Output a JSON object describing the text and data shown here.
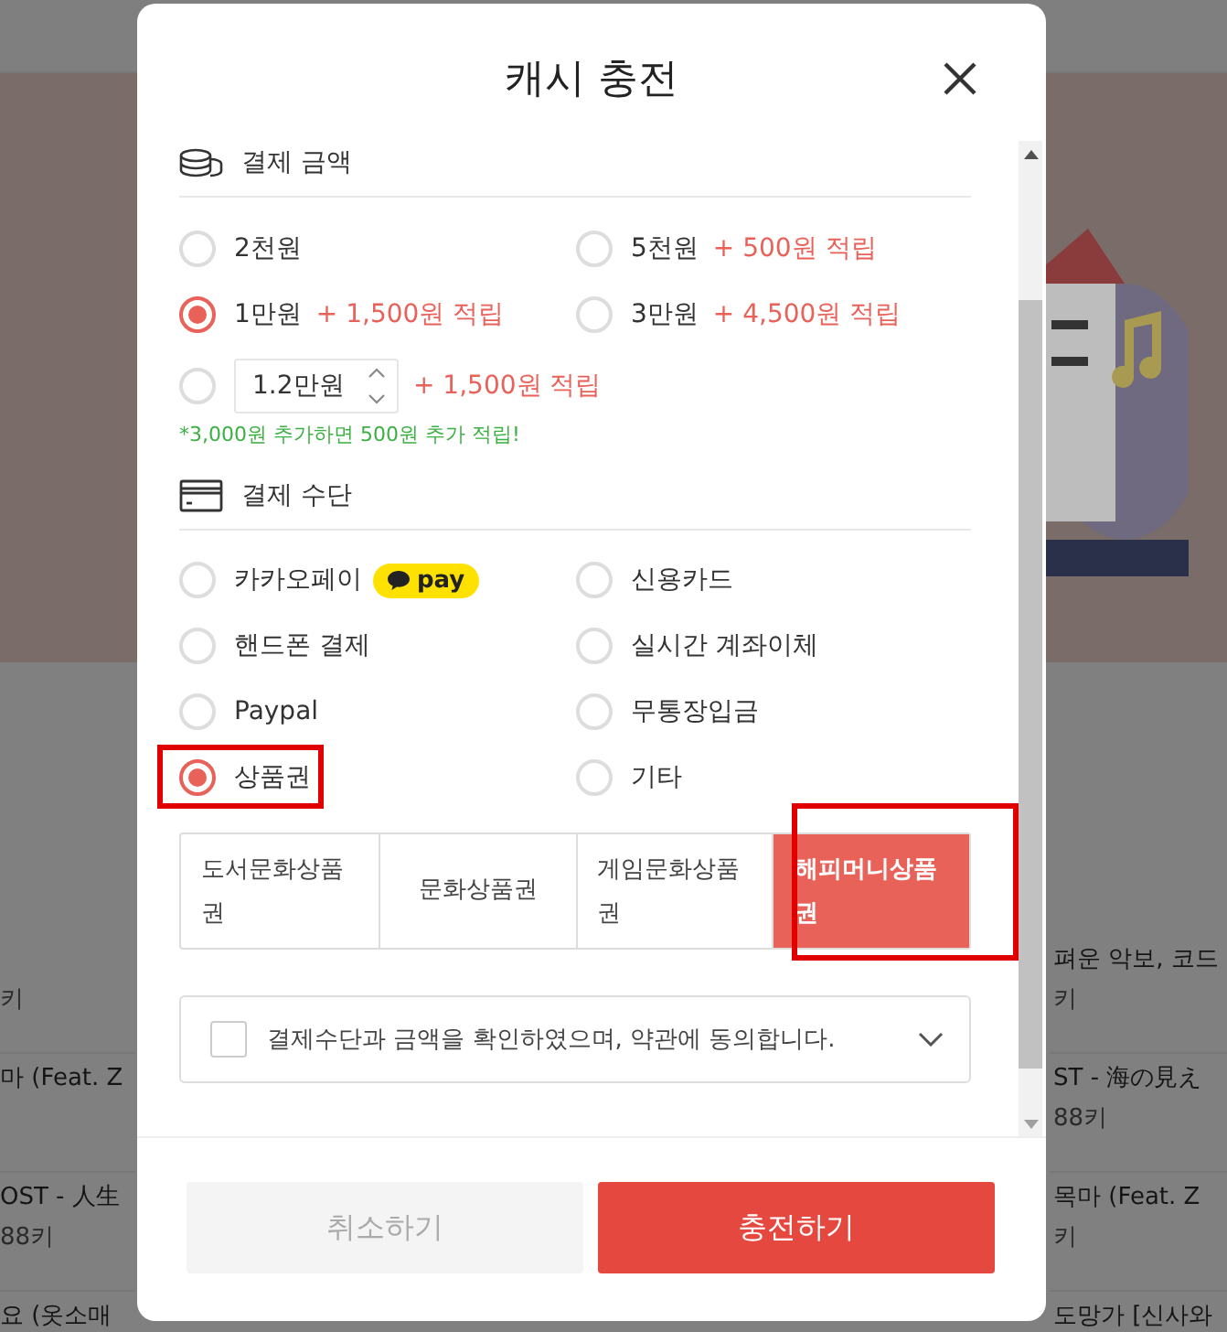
{
  "background": {
    "left_rows": [
      {
        "sub": "키"
      },
      {
        "title": "마 (Feat. Z"
      },
      {
        "title": "OST - 人生",
        "sub": "88키"
      },
      {
        "title": "요 (옷소매"
      }
    ],
    "right_rows": [
      {
        "title": "펴운 악보, 코드",
        "sub": "키"
      },
      {
        "title": "ST - 海の見え",
        "sub": "88키"
      },
      {
        "title": "목마 (Feat. Z",
        "sub": "키"
      },
      {
        "title": "도망가 [신사와"
      }
    ]
  },
  "dialog": {
    "title": "캐시 충전",
    "amount_section": {
      "title": "결제 금액",
      "options": [
        {
          "kind": "preset",
          "label": "2천원",
          "selected": false
        },
        {
          "kind": "preset",
          "label": "5천원",
          "bonus": "+ 500원 적립",
          "selected": false
        },
        {
          "kind": "preset",
          "label": "1만원",
          "bonus": "+ 1,500원 적립",
          "selected": true
        },
        {
          "kind": "preset",
          "label": "3만원",
          "bonus": "+ 4,500원 적립",
          "selected": false
        },
        {
          "kind": "custom",
          "value": "1.2만원",
          "bonus": "+ 1,500원 적립",
          "selected": false
        }
      ],
      "note": "*3,000원 추가하면 500원 추가 적립!"
    },
    "method_section": {
      "title": "결제 수단",
      "options": [
        {
          "label": "카카오페이",
          "badge": "pay",
          "selected": false,
          "highlighted": false
        },
        {
          "label": "신용카드",
          "selected": false,
          "highlighted": false
        },
        {
          "label": "핸드폰 결제",
          "selected": false,
          "highlighted": false
        },
        {
          "label": "실시간 계좌이체",
          "selected": false,
          "highlighted": false
        },
        {
          "label": "Paypal",
          "selected": false,
          "highlighted": false
        },
        {
          "label": "무통장입금",
          "selected": false,
          "highlighted": false
        },
        {
          "label": "상품권",
          "selected": true,
          "highlighted": true
        },
        {
          "label": "기타",
          "selected": false,
          "highlighted": false
        }
      ]
    },
    "vouchers": [
      {
        "label": "도서문화상품권",
        "selected": false,
        "highlighted": false
      },
      {
        "label": "문화상품권",
        "selected": false,
        "highlighted": false
      },
      {
        "label": "게임문화상품권",
        "selected": false,
        "highlighted": false
      },
      {
        "label": "해피머니상품권",
        "selected": true,
        "highlighted": true
      }
    ],
    "agreement": {
      "text": "결제수단과 금액을 확인하였으며, 약관에 동의합니다.",
      "checked": false
    },
    "buttons": {
      "cancel": "취소하기",
      "confirm": "충전하기"
    }
  }
}
